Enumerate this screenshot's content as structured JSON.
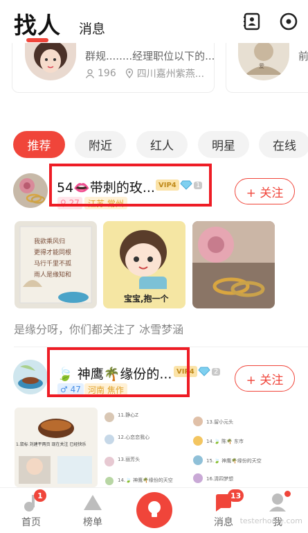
{
  "header": {
    "title": "找人",
    "tab_messages": "消息"
  },
  "group_cards": [
    {
      "text": "群规........经理职位以下的...",
      "members": "196",
      "location": "四川嘉州紫燕..."
    },
    {
      "text": "前",
      "members": "",
      "location": ""
    }
  ],
  "chips": [
    "推荐",
    "附近",
    "红人",
    "明星",
    "在线"
  ],
  "users": [
    {
      "name": "54👄带刺的玫...",
      "vip": "VIP4",
      "diamond": "1",
      "gender_age": "♀ 27",
      "location": "江苏 常州",
      "follow": "+ 关注",
      "common_text": "是缘分呀，你们都关注了 冰雪梦涵"
    },
    {
      "name": "🍃 神鹰🌴缘份的...",
      "vip": "VIP4",
      "diamond": "2",
      "gender_age": "♂ 47",
      "location": "河南 焦作",
      "follow": "+ 关注"
    }
  ],
  "photo_captions": {
    "photo2": "宝宝,抱一个"
  },
  "screens": {
    "s1_caption": "1.鼠标 刘建平两页 现在关注 已经快乐",
    "s2_items": [
      "11.静心Z",
      "12.心恋恋我心",
      "13.丽芳头",
      "14.🍃 神鹰🌴缘份的天空"
    ],
    "s3_items": [
      "13.留小元头",
      "14.🍃 陈🌴 东市",
      "15.🍃 神鹰🌴缘份的天空",
      "16.清四梦想"
    ]
  },
  "bottom_nav": [
    {
      "label": "首页",
      "badge": "1"
    },
    {
      "label": "榜单",
      "badge": ""
    },
    {
      "label": "",
      "badge": ""
    },
    {
      "label": "消息",
      "badge": "13"
    },
    {
      "label": "我",
      "badge": ""
    }
  ],
  "watermark": "testerhome.com",
  "colors": {
    "accent": "#f0453a",
    "annotation_box": "#ee1c25"
  }
}
